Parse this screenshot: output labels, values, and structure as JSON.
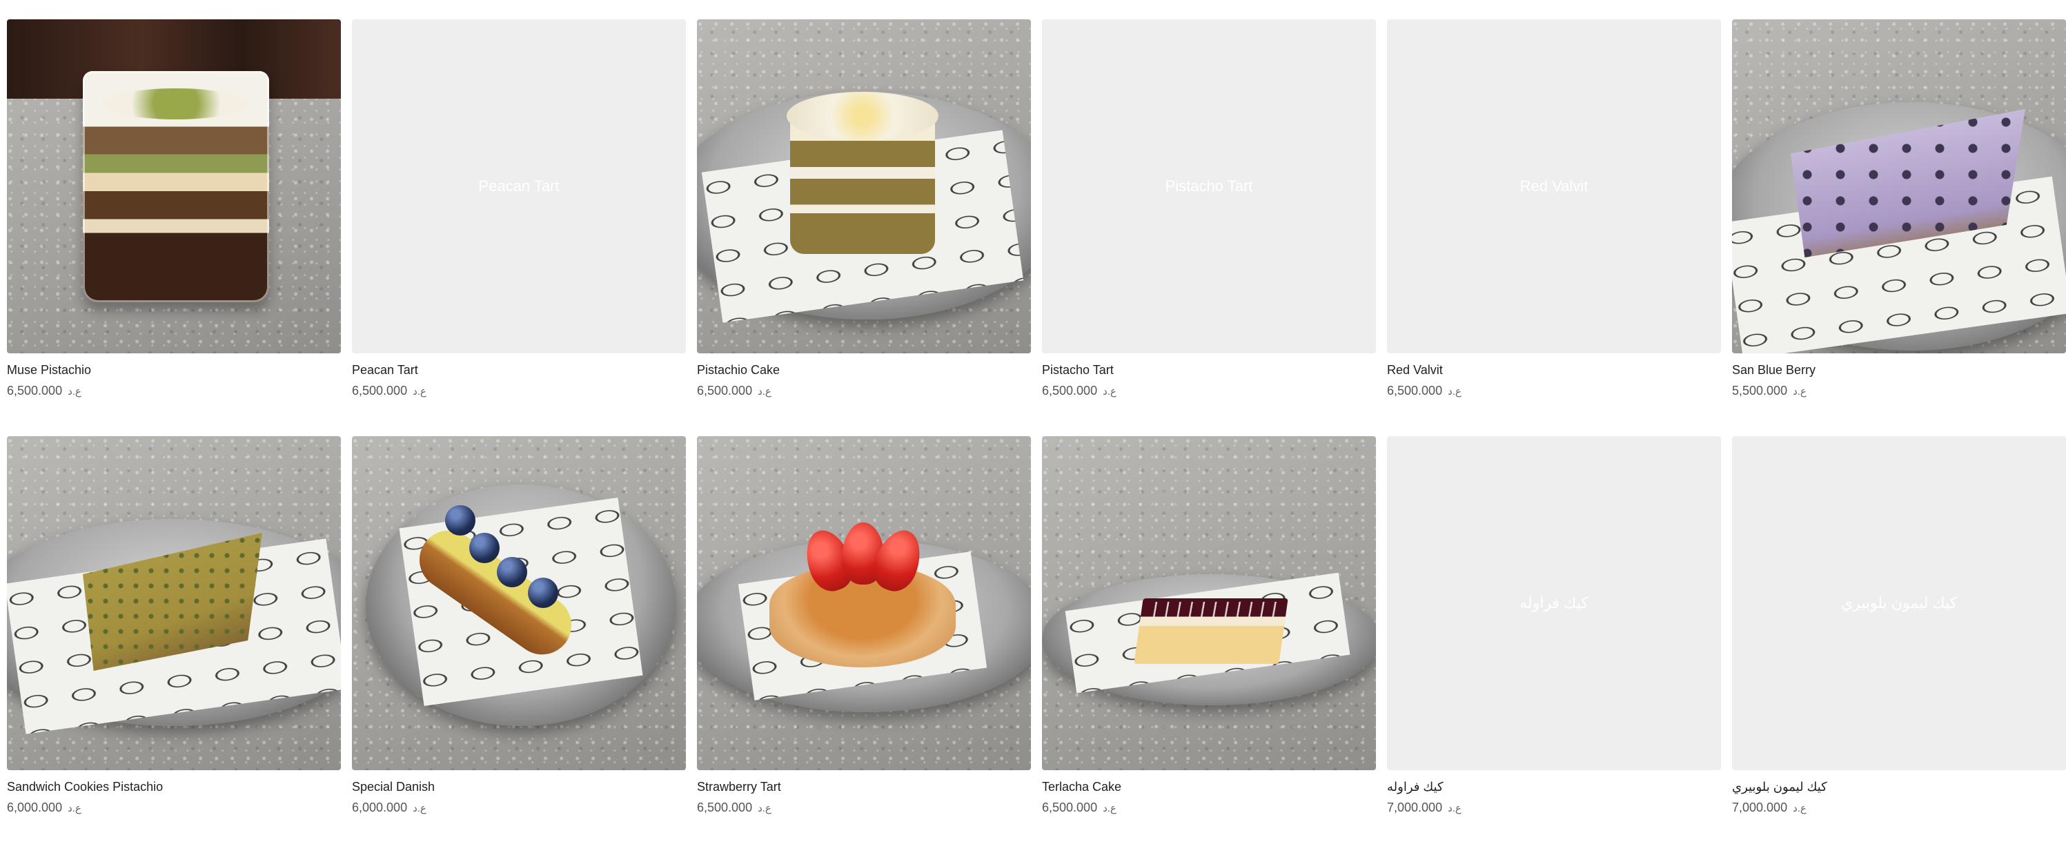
{
  "currency": "ع.د",
  "products": [
    {
      "name": "Muse Pistachio",
      "price": "6,500.000",
      "image": "muse-pistachio-photo",
      "placeholder": ""
    },
    {
      "name": "Peacan Tart",
      "price": "6,500.000",
      "image": "",
      "placeholder": "Peacan Tart"
    },
    {
      "name": "Pistachio Cake",
      "price": "6,500.000",
      "image": "pistachio-cake-photo",
      "placeholder": ""
    },
    {
      "name": "Pistacho Tart",
      "price": "6,500.000",
      "image": "",
      "placeholder": "Pistacho Tart"
    },
    {
      "name": "Red Valvit",
      "price": "6,500.000",
      "image": "",
      "placeholder": "Red Valvit"
    },
    {
      "name": "San Blue Berry",
      "price": "5,500.000",
      "image": "blueberry-cheesecake-photo",
      "placeholder": ""
    },
    {
      "name": "Sandwich Cookies Pistachio",
      "price": "6,000.000",
      "image": "pistachio-slice-photo",
      "placeholder": ""
    },
    {
      "name": "Special Danish",
      "price": "6,000.000",
      "image": "danish-photo",
      "placeholder": ""
    },
    {
      "name": "Strawberry Tart",
      "price": "6,500.000",
      "image": "strawberry-tart-photo",
      "placeholder": ""
    },
    {
      "name": "Terlacha Cake",
      "price": "6,500.000",
      "image": "terlacha-cake-photo",
      "placeholder": ""
    },
    {
      "name": "كيك فراوله",
      "price": "7,000.000",
      "image": "",
      "placeholder": "كيك فراوله"
    },
    {
      "name": "كيك ليمون بلوبيري",
      "price": "7,000.000",
      "image": "",
      "placeholder": "كيك ليمون بلوبيري"
    }
  ]
}
